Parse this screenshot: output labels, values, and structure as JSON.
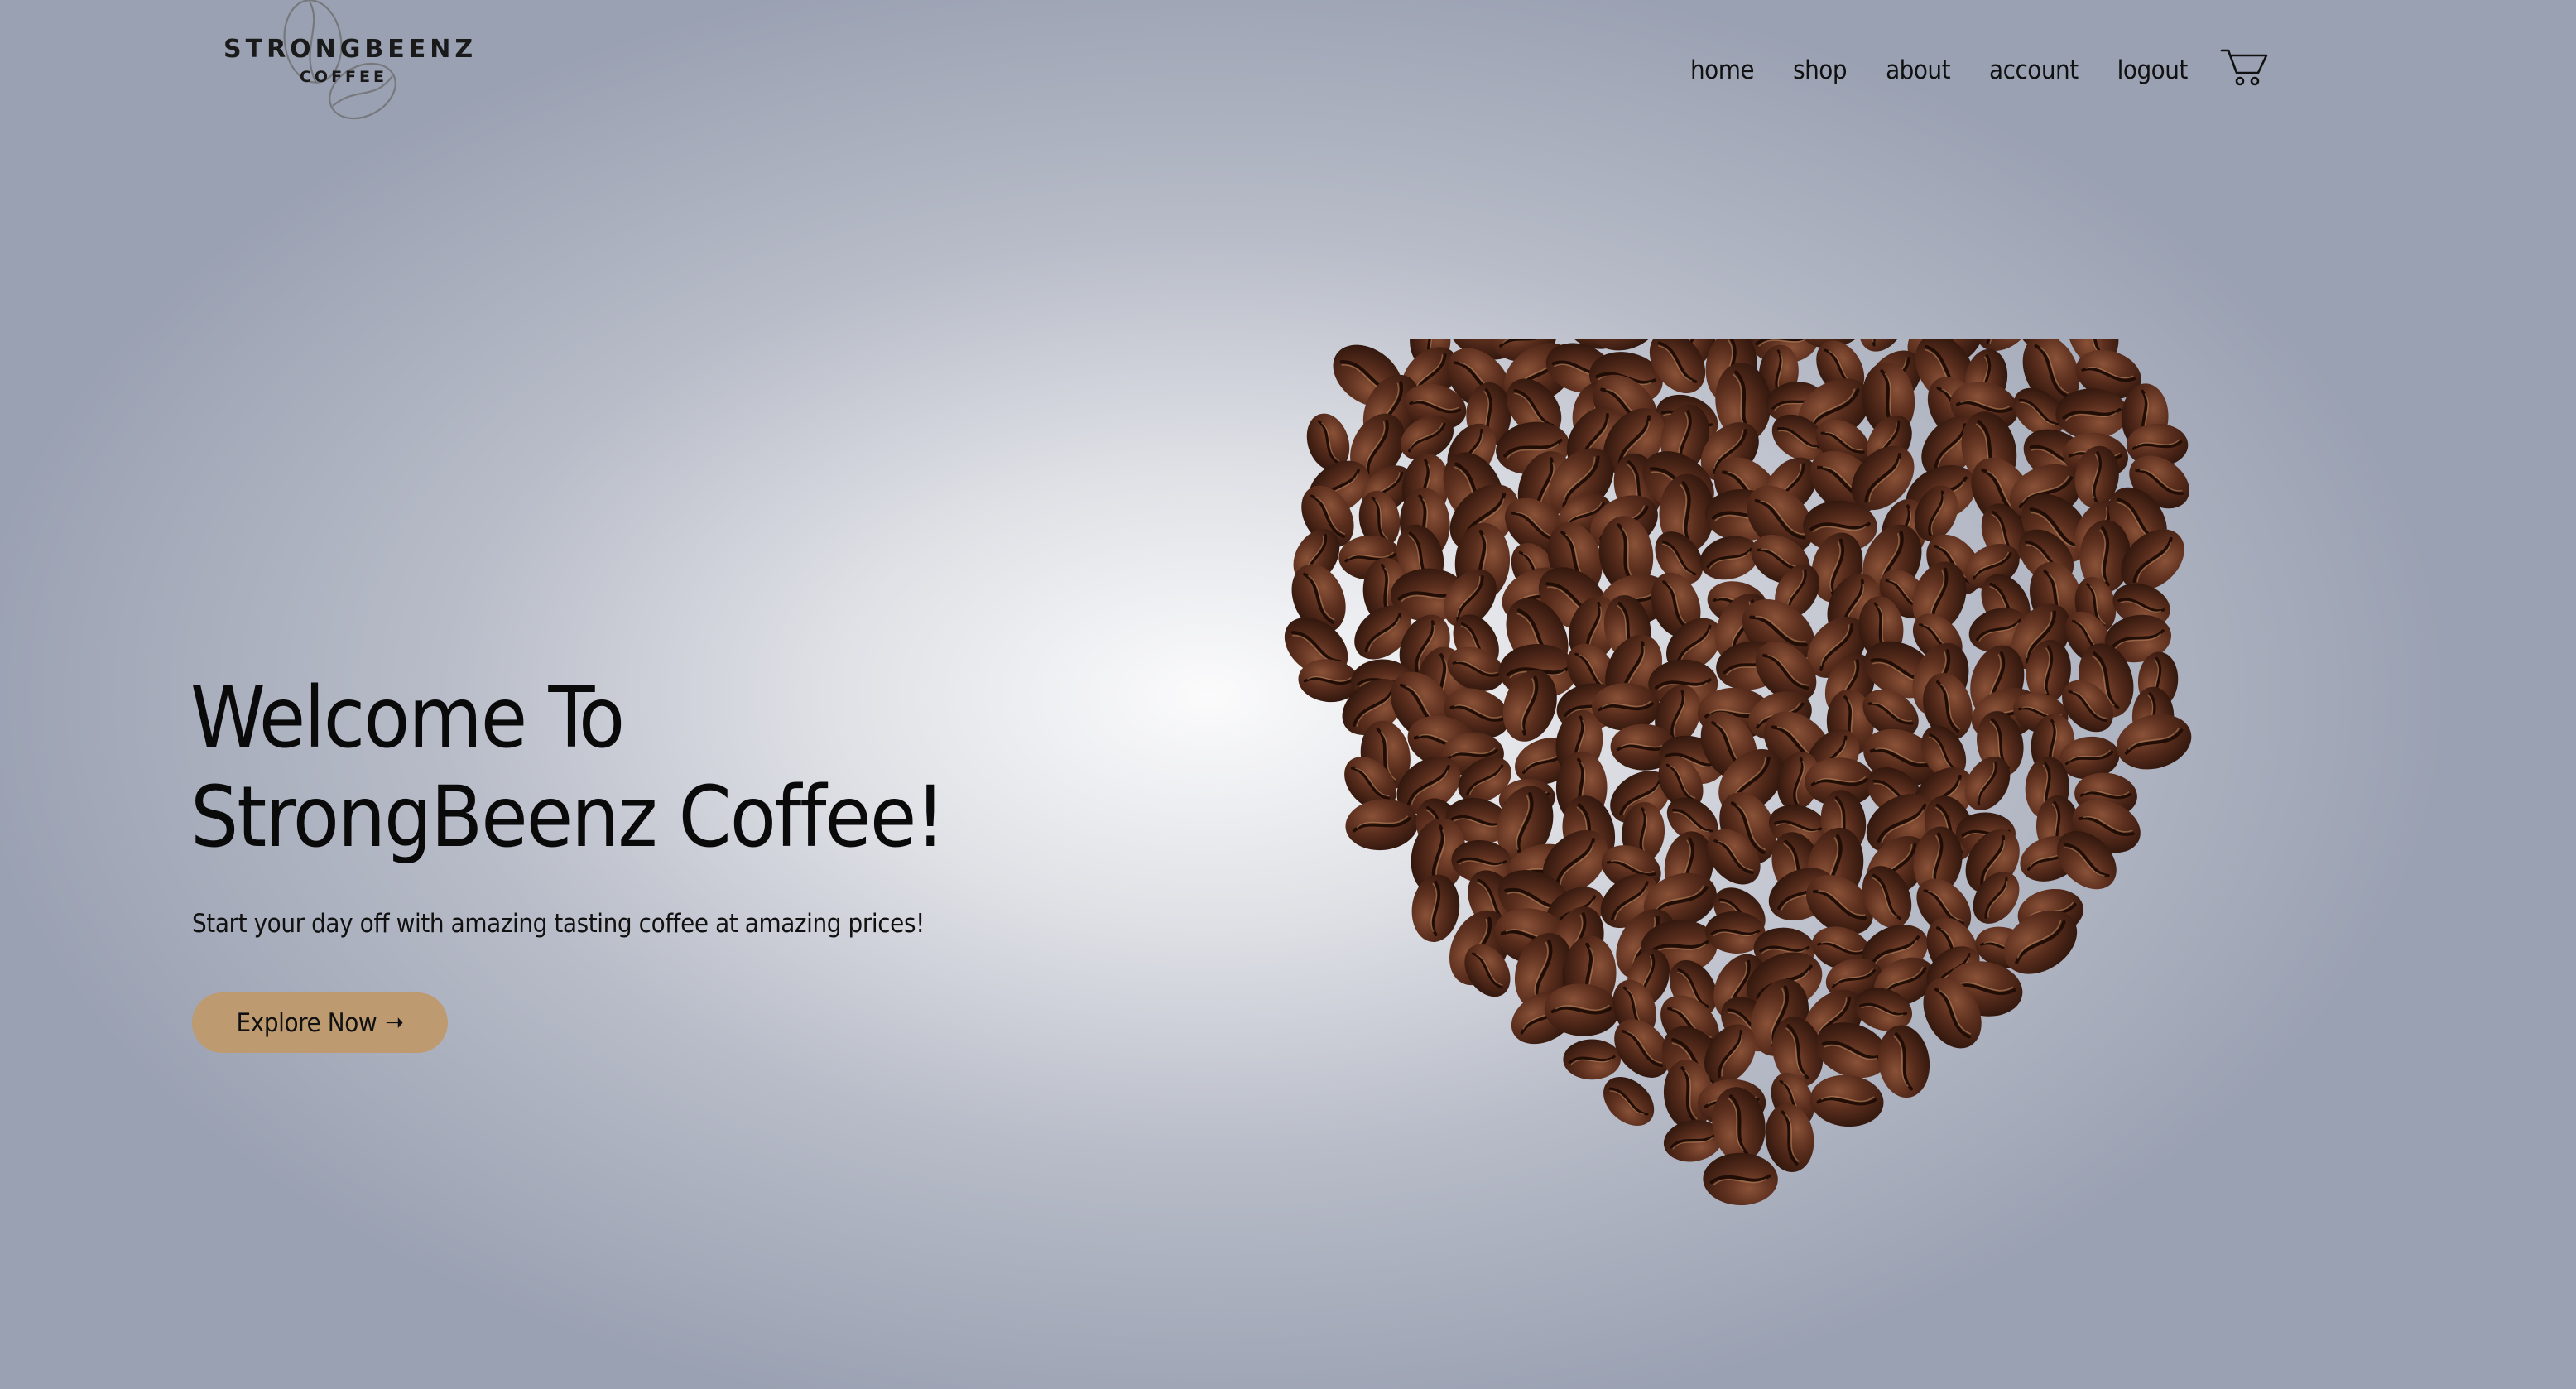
{
  "brand": {
    "name": "STRONGBEENZ",
    "sub": "COFFEE"
  },
  "nav": {
    "items": [
      {
        "label": "home"
      },
      {
        "label": "shop"
      },
      {
        "label": "about"
      },
      {
        "label": "account"
      },
      {
        "label": "logout"
      }
    ],
    "cart_icon": "shopping-cart-icon"
  },
  "hero": {
    "title_line1": "Welcome To",
    "title_line2": "StrongBeenz Coffee!",
    "subtitle": "Start your day off with amazing tasting coffee at amazing prices!",
    "cta_label": "Explore Now",
    "cta_arrow": "➝",
    "image": "coffee-bean-heart"
  },
  "colors": {
    "accent": "#bd9a6f",
    "bean": "#4e2818",
    "text": "#0d0d0d"
  }
}
